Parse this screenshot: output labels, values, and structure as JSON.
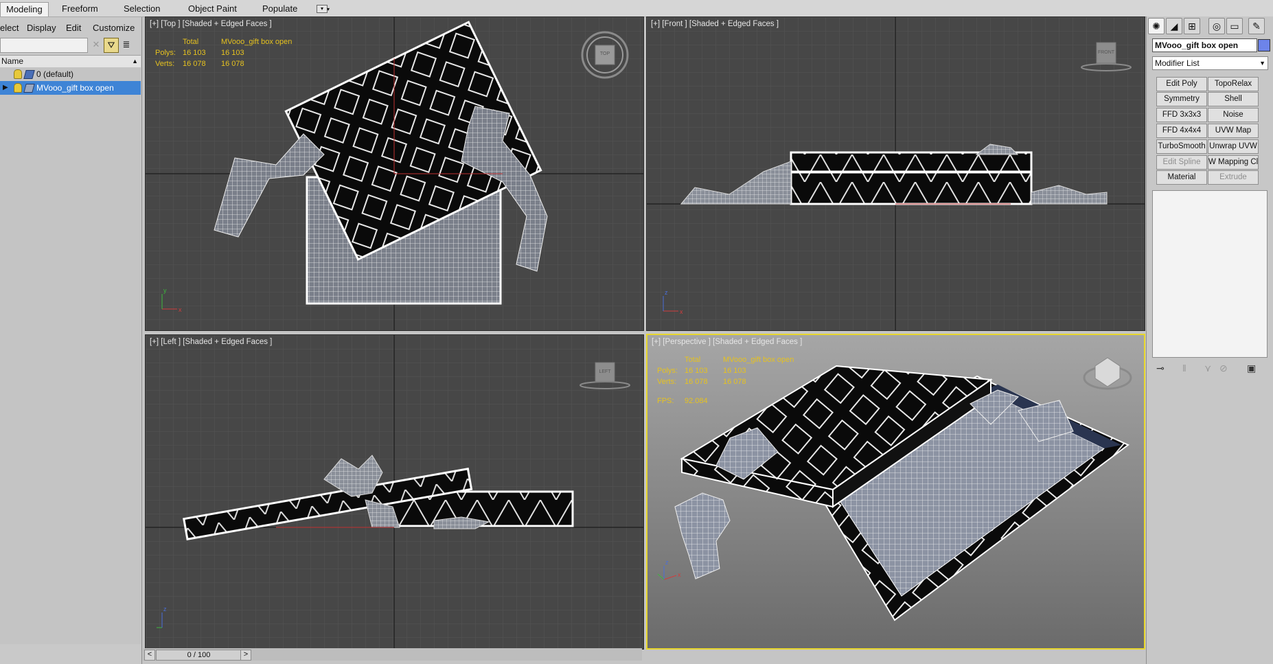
{
  "ribbon": {
    "tabs": [
      "Modeling",
      "Freeform",
      "Selection",
      "Object Paint",
      "Populate"
    ],
    "dropdown_icon": "dropdown-icon"
  },
  "explorer": {
    "menu": [
      "elect",
      "Display",
      "Edit",
      "Customize"
    ],
    "column_header": "Name",
    "items": [
      {
        "label": "0 (default)",
        "selected": false
      },
      {
        "label": "MVooo_gift box open",
        "selected": true
      }
    ]
  },
  "viewports": {
    "top": {
      "label": "[+] [Top ] [Shaded + Edged Faces ]",
      "gizmo": "TOP"
    },
    "front": {
      "label": "[+] [Front ] [Shaded + Edged Faces ]",
      "gizmo": "FRONT"
    },
    "left": {
      "label": "[+] [Left ] [Shaded + Edged Faces ]",
      "gizmo": "LEFT"
    },
    "perspective": {
      "label": "[+] [Perspective ] [Shaded + Edged Faces ]"
    }
  },
  "stats": {
    "total_header": "Total",
    "object_header": "MVooo_gift box open",
    "polys_label": "Polys:",
    "verts_label": "Verts:",
    "polys_total": "16 103",
    "polys_object": "16 103",
    "verts_total": "16 078",
    "verts_object": "16 078",
    "fps_label": "FPS:",
    "fps_value": "92.084"
  },
  "command_panel": {
    "object_name": "MVooo_gift box open",
    "object_color": "#6d84ea",
    "modifier_list": "Modifier List",
    "buttons": [
      {
        "label": "Edit Poly",
        "disabled": false
      },
      {
        "label": "TopoRelax",
        "disabled": false
      },
      {
        "label": "Symmetry",
        "disabled": false
      },
      {
        "label": "Shell",
        "disabled": false
      },
      {
        "label": "FFD 3x3x3",
        "disabled": false
      },
      {
        "label": "Noise",
        "disabled": false
      },
      {
        "label": "FFD 4x4x4",
        "disabled": false
      },
      {
        "label": "UVW Map",
        "disabled": false
      },
      {
        "label": "TurboSmooth",
        "disabled": false
      },
      {
        "label": "Unwrap UVW",
        "disabled": false
      },
      {
        "label": "Edit Spline",
        "disabled": true
      },
      {
        "label": "W Mapping Cle",
        "disabled": false
      },
      {
        "label": "Material",
        "disabled": false
      },
      {
        "label": "Extrude",
        "disabled": true
      }
    ]
  },
  "timeline": {
    "frame": "0 / 100",
    "prev": "<",
    "next": ">"
  },
  "colors": {
    "viewport_bg": "#474747",
    "active_border": "#e8d72d",
    "stats_text": "#e6c21f",
    "selection": "#3e84d6"
  }
}
